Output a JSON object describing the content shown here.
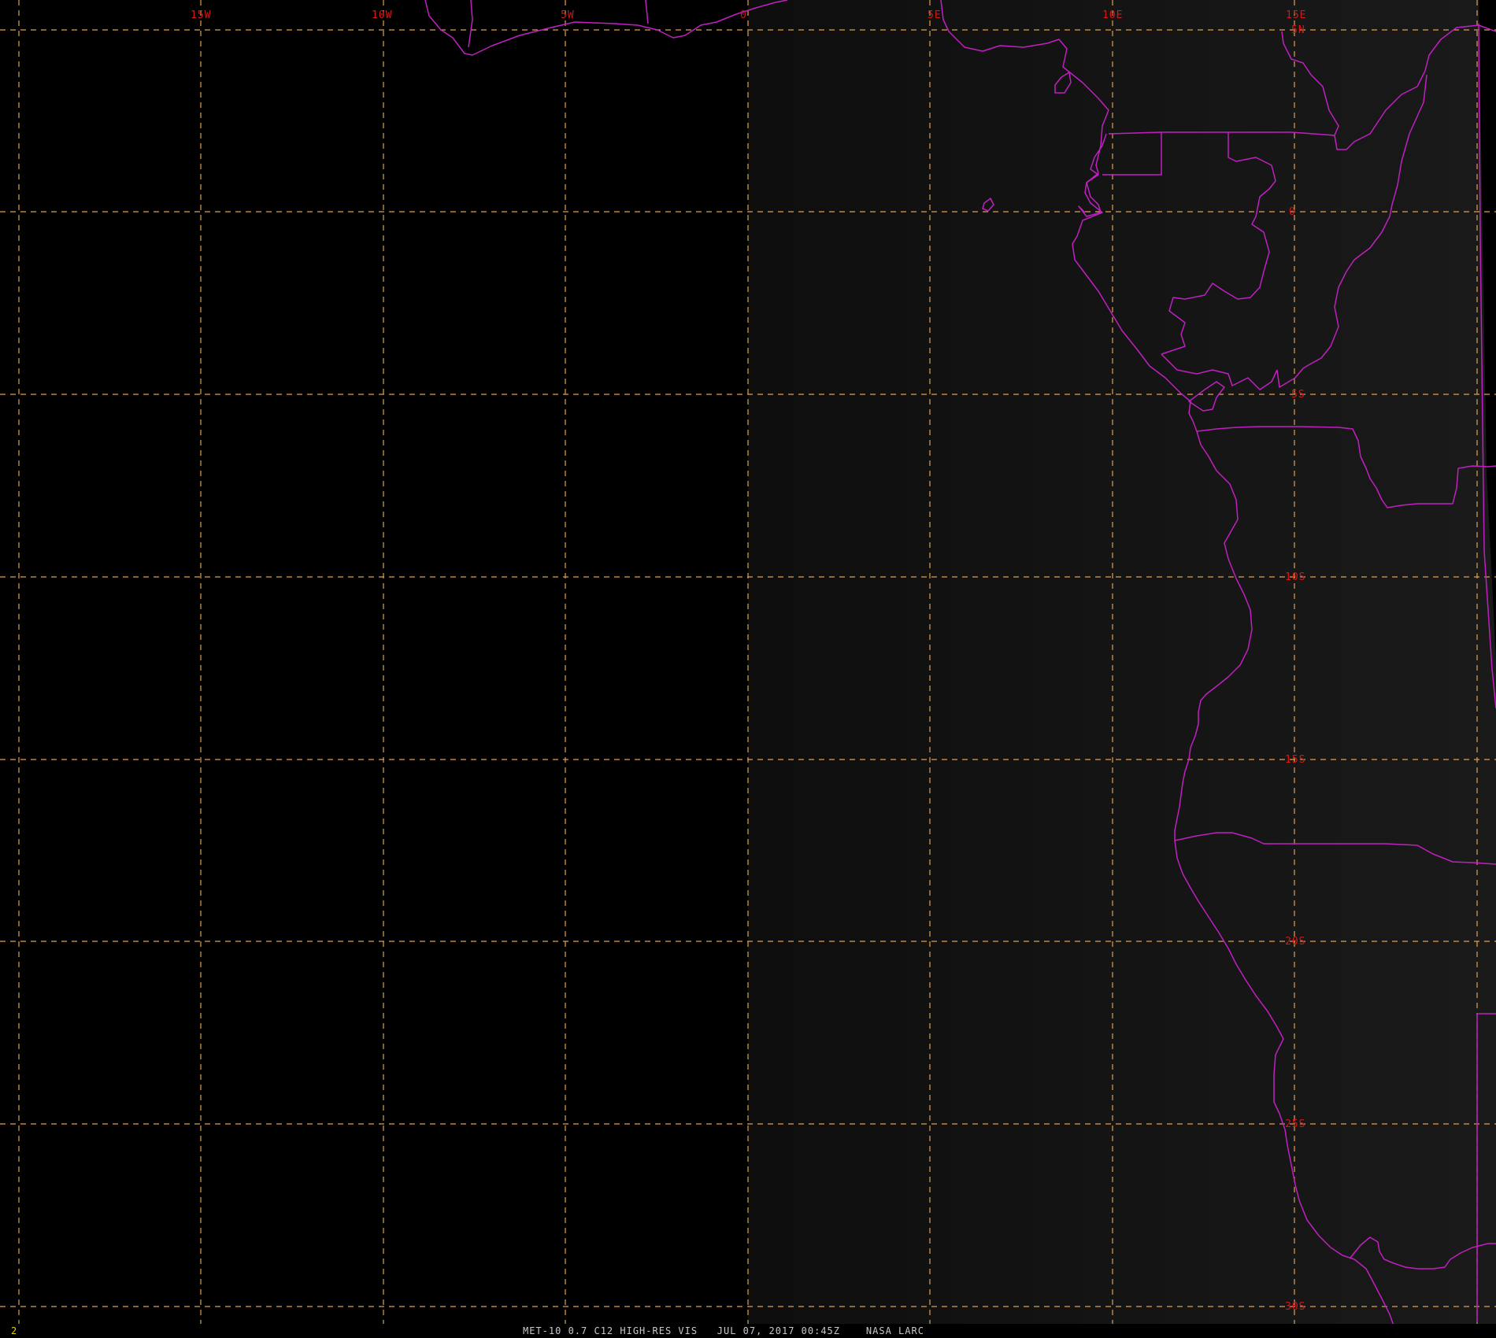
{
  "map": {
    "lon_labels": [
      "15W",
      "10W",
      "5W",
      "0",
      "5E",
      "10E",
      "15E"
    ],
    "lat_labels": [
      "5N",
      "0",
      "5S",
      "10S",
      "15S",
      "20S",
      "25S",
      "30S"
    ],
    "colors": {
      "grid": "#e0a050",
      "coastline": "#c020c0",
      "label": "#d21818"
    }
  },
  "footer": {
    "frame_number": "2",
    "caption": "MET-10 0.7 C12 HIGH-RES VIS   JUL 07, 2017 00:45Z    NASA LARC"
  }
}
